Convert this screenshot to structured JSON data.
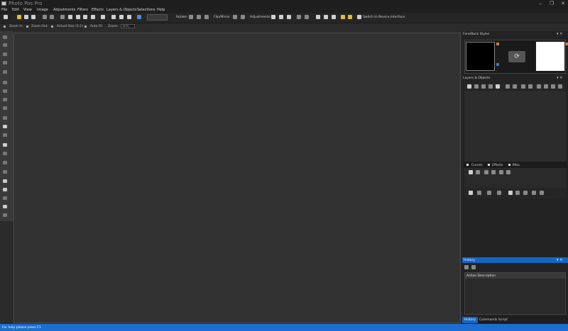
{
  "app": {
    "title": "Photo Pos Pro",
    "window_buttons": [
      "–",
      "❐",
      "✕"
    ]
  },
  "menu": [
    "File",
    "Edit",
    "View",
    "Image",
    "Adjustments",
    "Filters",
    "Effects",
    "Layers & Objects",
    "Selections",
    "Help"
  ],
  "toolbar": {
    "rotate_label": "Rotate:",
    "flip_label": "Flip/Mirror",
    "adjustments_label": "Adjustments:",
    "novice_label": "Switch to Novice Interface"
  },
  "zoombar": {
    "zoom_in": "Zoom In",
    "zoom_out": "Zoom Out",
    "actual_size": "Actual Size (1:1)",
    "auto_fit": "Auto Fit",
    "zoom_label": "Zoom:",
    "zoom_value": "100%"
  },
  "panels": {
    "foreback": {
      "title": "Fore/Back Styles"
    },
    "layers": {
      "title": "Layers & Objects"
    },
    "tabs": [
      "Curves",
      "Effects",
      "Misc."
    ],
    "history": {
      "title": "History",
      "column": "Action Description",
      "tabs": [
        "History",
        "Commands Script"
      ]
    }
  },
  "status": {
    "text": "For help please press F1"
  },
  "colors": {
    "accent": "#1466c4",
    "status_bar": "#1a6fd0",
    "fore_color": "#000000",
    "back_color": "#ffffff"
  }
}
